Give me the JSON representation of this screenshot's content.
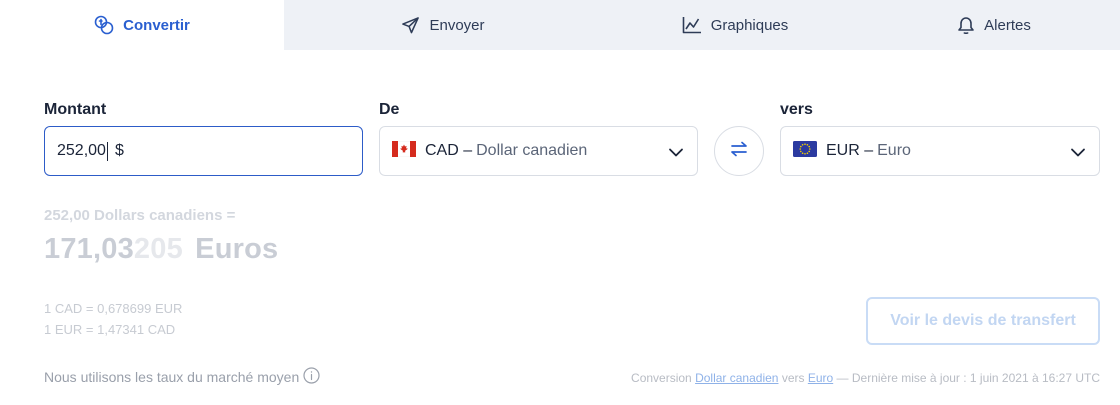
{
  "tabs": [
    {
      "label": "Convertir",
      "icon": "money-convert-icon",
      "active": true
    },
    {
      "label": "Envoyer",
      "icon": "send-icon",
      "active": false
    },
    {
      "label": "Graphiques",
      "icon": "chart-icon",
      "active": false
    },
    {
      "label": "Alertes",
      "icon": "bell-icon",
      "active": false
    }
  ],
  "amount": {
    "label": "Montant",
    "value": "252,00",
    "symbol": "$"
  },
  "from": {
    "label": "De",
    "code": "CAD –",
    "name": "Dollar canadien",
    "flag": "canada-flag"
  },
  "to": {
    "label": "vers",
    "code": "EUR –",
    "name": "Euro",
    "flag": "eu-flag"
  },
  "swap": {
    "icon": "swap-arrows-icon"
  },
  "result": {
    "sub": "252,00 Dollars canadiens =",
    "main_strong": "171,03",
    "main_faded": "205",
    "main_unit": "Euros"
  },
  "rates": [
    "1 CAD = 0,678699 EUR",
    "1 EUR = 1,47341 CAD"
  ],
  "quote_button": "Voir le devis de transfert",
  "note": "Nous utilisons les taux du marché moyen",
  "footer": {
    "prefix": "Conversion",
    "link1": "Dollar canadien",
    "middle": "vers",
    "link2": "Euro",
    "suffix": "— Dernière mise à jour : 1 juin 2021 à 16:27 UTC"
  },
  "colors": {
    "accent": "#2a5fd0",
    "tab_bg": "#eef1f6",
    "border": "#d9dde4"
  }
}
